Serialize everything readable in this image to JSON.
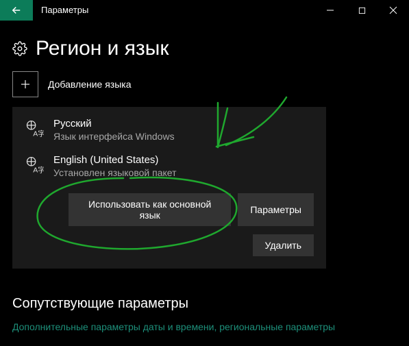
{
  "window": {
    "title": "Параметры"
  },
  "page": {
    "heading": "Регион и язык",
    "add_language": "Добавление языка"
  },
  "languages": [
    {
      "name": "Русский",
      "subtitle": "Язык интерфейса Windows"
    },
    {
      "name": "English (United States)",
      "subtitle": "Установлен языковой пакет"
    }
  ],
  "buttons": {
    "set_default": "Использовать как основной язык",
    "options": "Параметры",
    "remove": "Удалить"
  },
  "related": {
    "heading": "Сопутствующие параметры",
    "link": "Дополнительные параметры даты и времени, региональные параметры"
  }
}
